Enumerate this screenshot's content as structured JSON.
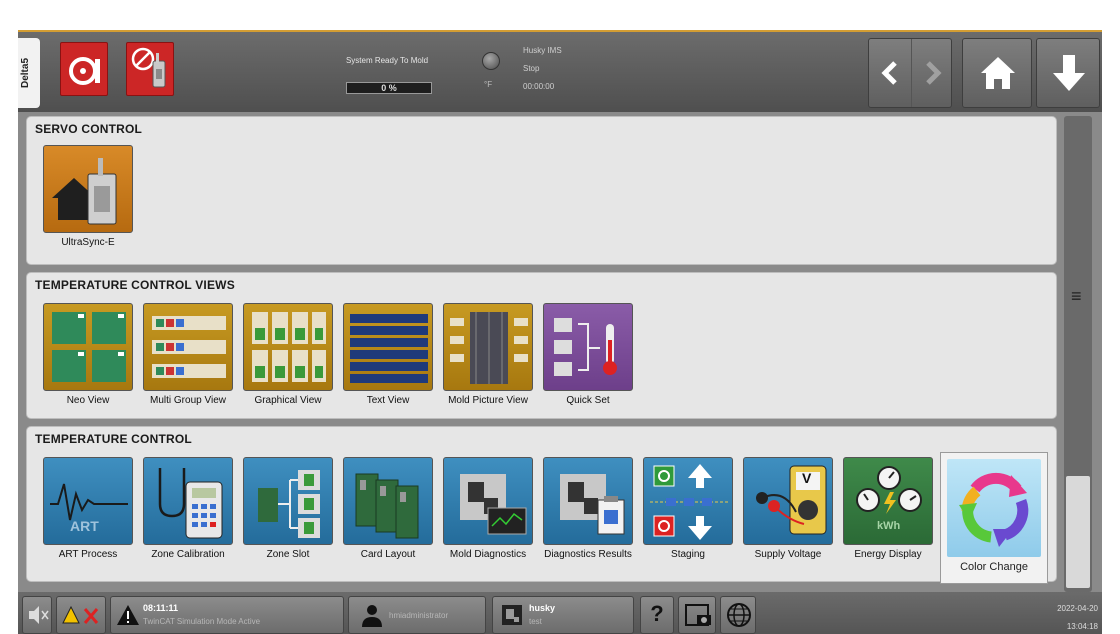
{
  "header": {
    "machine_tab": "Delta5",
    "status_text": "System Ready To Mold",
    "progress_label": "0 %",
    "progress_fraction": 0,
    "led_value": "°F",
    "ims_title": "Husky IMS",
    "ims_state": "Stop",
    "ims_time": "00:00:00"
  },
  "sections": {
    "servo": {
      "title": "SERVO CONTROL",
      "tiles": [
        {
          "label": "UltraSync-E"
        }
      ]
    },
    "views": {
      "title": "TEMPERATURE CONTROL VIEWS",
      "tiles": [
        {
          "label": "Neo View"
        },
        {
          "label": "Multi Group View"
        },
        {
          "label": "Graphical View"
        },
        {
          "label": "Text View"
        },
        {
          "label": "Mold Picture View"
        },
        {
          "label": "Quick Set"
        }
      ]
    },
    "control": {
      "title": "TEMPERATURE CONTROL",
      "tiles": [
        {
          "label": "ART Process",
          "icon_text": "ART"
        },
        {
          "label": "Zone Calibration"
        },
        {
          "label": "Zone Slot"
        },
        {
          "label": "Card Layout"
        },
        {
          "label": "Mold Diagnostics"
        },
        {
          "label": "Diagnostics Results"
        },
        {
          "label": "Staging"
        },
        {
          "label": "Supply Voltage",
          "icon_text": "V"
        },
        {
          "label": "Energy Display",
          "icon_text": "kWh"
        },
        {
          "label": "Color Change"
        }
      ]
    }
  },
  "footer": {
    "time": "08:11:11",
    "message": "TwinCAT Simulation Mode Active",
    "user": "hmiadministrator",
    "profile_name": "husky",
    "profile_sub": "test",
    "help": "?",
    "date": "2022-04-20",
    "clock_time": "13:04:18"
  },
  "colors": {
    "accent_line": "#d39d33",
    "alarm_red": "#cc2626",
    "servo_tile": "#c8781a",
    "view_tile": "#b88a18",
    "control_tile": "#2f7fb0",
    "quick_set": "#7b4d99",
    "energy": "#2f7a3c"
  }
}
